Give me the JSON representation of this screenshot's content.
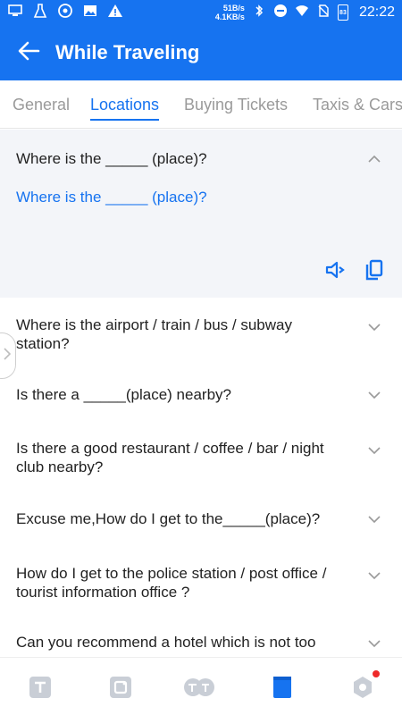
{
  "status_bar": {
    "net_speed_up": "51B/s",
    "net_speed_down": "4.1KB/s",
    "battery": "83",
    "time": "22:22"
  },
  "app_bar": {
    "title": "While Traveling"
  },
  "tabs": [
    {
      "label": "General",
      "active": false
    },
    {
      "label": "Locations",
      "active": true
    },
    {
      "label": "Buying Tickets",
      "active": false
    },
    {
      "label": "Taxis & Cars",
      "active": false
    }
  ],
  "expanded_phrase": {
    "question": "Where is the _____ (place)?",
    "translation": "Where is the _____ (place)?"
  },
  "phrases": [
    {
      "text": "Where is the airport / train / bus / subway station?"
    },
    {
      "text": "Is there a _____(place) nearby?"
    },
    {
      "text": "Is there a good restaurant / coffee / bar / night club nearby?"
    },
    {
      "text": "Excuse me,How do I get to the_____(place)?"
    },
    {
      "text": "How do I get to the police station / post office / tourist information office ?"
    },
    {
      "text": "Can you recommend a hotel which is not too expensive?"
    }
  ],
  "colors": {
    "brand": "#1673f0",
    "expanded_bg": "#f3f5f9",
    "inactive_tab": "#9a9a9a",
    "notification_dot": "#ee2a2a"
  },
  "icons": {
    "back": "arrow-left-icon",
    "collapse": "chevron-up-icon",
    "expand": "chevron-down-icon",
    "speak": "speaker-icon",
    "copy": "copy-icon"
  }
}
